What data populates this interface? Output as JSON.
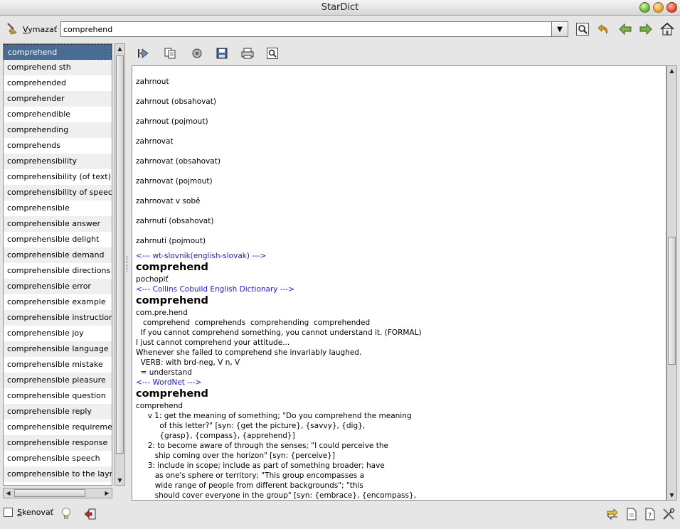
{
  "window": {
    "title": "StarDict"
  },
  "toolbar": {
    "clear_label": "Vymazať",
    "search_value": "comprehend",
    "icons": [
      "find-icon",
      "back-icon",
      "prev-icon",
      "next-icon",
      "home-icon"
    ]
  },
  "wordlist": {
    "selected_index": 0,
    "items": [
      "comprehend",
      "comprehend sth",
      "comprehended",
      "comprehender",
      "comprehendible",
      "comprehending",
      "comprehends",
      "comprehensibility",
      "comprehensibility (of text)",
      "comprehensibility of speech",
      "comprehensible",
      "comprehensible answer",
      "comprehensible delight",
      "comprehensible demand",
      "comprehensible directions",
      "comprehensible error",
      "comprehensible example",
      "comprehensible instruction",
      "comprehensible joy",
      "comprehensible language",
      "comprehensible mistake",
      "comprehensible pleasure",
      "comprehensible question",
      "comprehensible reply",
      "comprehensible requirement",
      "comprehensible response",
      "comprehensible speech",
      "comprehensible to the layman"
    ]
  },
  "definition": {
    "hits": [
      "zahrnout",
      "zahrnout (obsahovat)",
      "zahrnout (pojmout)",
      "zahrnovat",
      "zahrnovat (obsahovat)",
      "zahrnovat (pojmout)",
      "zahrnovat v sobě",
      "zahrnutí (obsahovat)",
      "zahrnutí (pojmout)"
    ],
    "dict1": {
      "name": "<--- wt-slovnik(english-slovak) --->",
      "headword": "comprehend",
      "body": [
        "pochopiť"
      ]
    },
    "dict2": {
      "name": "<--- Collins Cobuild English Dictionary --->",
      "headword": "comprehend",
      "body": [
        "com.pre.hend",
        "   comprehend  comprehends  comprehending  comprehended",
        "  If you cannot comprehend something, you cannot understand it. (FORMAL)",
        "I just cannot comprehend your attitude...",
        "Whenever she failed to comprehend she invariably laughed.",
        "  VERB: with brd-neg, V n, V",
        "  = understand"
      ]
    },
    "dict3": {
      "name": "<--- WordNet --->",
      "headword": "comprehend",
      "body": [
        "comprehend",
        "     v 1: get the meaning of something; \"Do you comprehend the meaning",
        "          of this letter?\" [syn: {get the picture}, {savvy}, {dig},",
        "          {grasp}, {compass}, {apprehend}]",
        "     2: to become aware of through the senses; \"I could perceive the",
        "        ship coming over the horizon\" [syn: {perceive}]",
        "     3: include in scope; include as part of something broader; have",
        "        as one's sphere or territory; \"This group encompasses a",
        "        wide range of people from different backgrounds\"; \"this",
        "        should cover everyone in the group\" [syn: {embrace}, {encompass},"
      ]
    }
  },
  "statusbar": {
    "scan_label": "Skenovať"
  },
  "colors": {
    "selection": "#4b6c92",
    "dictname": "#1a1ad6"
  }
}
